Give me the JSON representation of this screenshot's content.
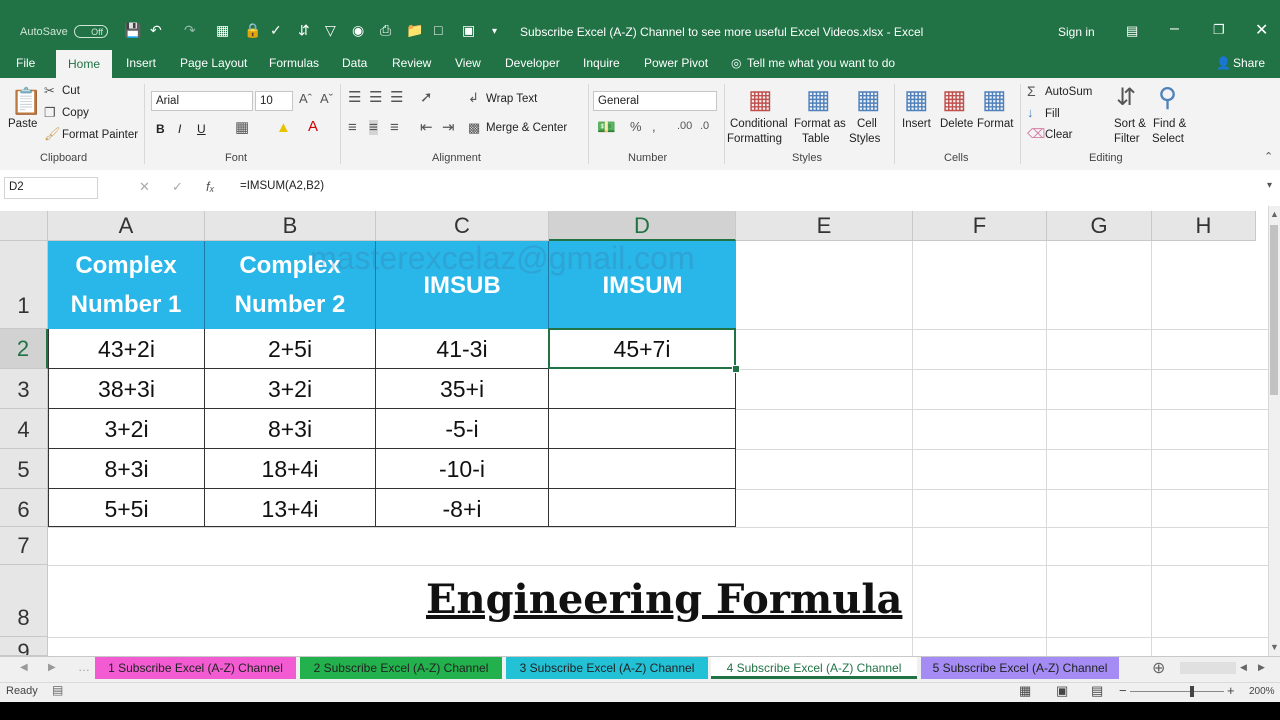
{
  "titlebar": {
    "autosave_label": "AutoSave",
    "autosave_state": "Off",
    "title": "Subscribe Excel (A-Z) Channel to see more useful Excel Videos.xlsx  -  Excel",
    "signin": "Sign in"
  },
  "tabs": [
    "File",
    "Home",
    "Insert",
    "Page Layout",
    "Formulas",
    "Data",
    "Review",
    "View",
    "Developer",
    "Inquire",
    "Power Pivot"
  ],
  "tell_me": "Tell me what you want to do",
  "share": "Share",
  "ribbon": {
    "clipboard": {
      "paste": "Paste",
      "cut": "Cut",
      "copy": "Copy",
      "format_painter": "Format Painter",
      "label": "Clipboard"
    },
    "font": {
      "name": "Arial",
      "size": "10",
      "bold": "B",
      "italic": "I",
      "underline": "U",
      "label": "Font"
    },
    "alignment": {
      "wrap": "Wrap Text",
      "merge": "Merge & Center",
      "label": "Alignment"
    },
    "number": {
      "format": "General",
      "label": "Number"
    },
    "styles": {
      "conditional": "Conditional",
      "formatting": "Formatting",
      "format_as": "Format as",
      "table": "Table",
      "cell": "Cell",
      "styles": "Styles",
      "label": "Styles"
    },
    "cells": {
      "insert": "Insert",
      "delete": "Delete",
      "format": "Format",
      "label": "Cells"
    },
    "editing": {
      "autosum": "AutoSum",
      "fill": "Fill",
      "clear": "Clear",
      "sort": "Sort &",
      "filter": "Filter",
      "find": "Find &",
      "select": "Select",
      "label": "Editing"
    }
  },
  "formula_bar": {
    "name_box": "D2",
    "formula": "=IMSUM(A2,B2)"
  },
  "columns": [
    "A",
    "B",
    "C",
    "D",
    "E",
    "F",
    "G",
    "H"
  ],
  "rows": [
    "1",
    "2",
    "3",
    "4",
    "5",
    "6",
    "7",
    "8",
    "9"
  ],
  "table": {
    "headers": [
      "Complex\nNumber 1",
      "Complex\nNumber 2",
      "IMSUB",
      "IMSUM"
    ],
    "data": [
      [
        "43+2i",
        "2+5i",
        "41-3i",
        "45+7i"
      ],
      [
        "38+3i",
        "3+2i",
        "35+i",
        ""
      ],
      [
        "3+2i",
        "8+3i",
        "-5-i",
        ""
      ],
      [
        "8+3i",
        "18+4i",
        "-10-i",
        ""
      ],
      [
        "5+5i",
        "13+4i",
        "-8+i",
        ""
      ]
    ]
  },
  "watermark": "masterexcelaz@gmail.com",
  "banner": "Engineering Formula",
  "sheets": [
    {
      "name": "1 Subscribe Excel (A-Z) Channel",
      "color": "#f25bd1"
    },
    {
      "name": "2 Subscribe Excel (A-Z) Channel",
      "color": "#22b14c"
    },
    {
      "name": "3 Subscribe Excel (A-Z) Channel",
      "color": "#22c1d6"
    },
    {
      "name": "4 Subscribe Excel (A-Z) Channel",
      "color": "#f7f7c8"
    },
    {
      "name": "5 Subscribe Excel (A-Z) Channel",
      "color": "#a58cf5"
    }
  ],
  "status": {
    "ready": "Ready",
    "zoom": "200%"
  }
}
